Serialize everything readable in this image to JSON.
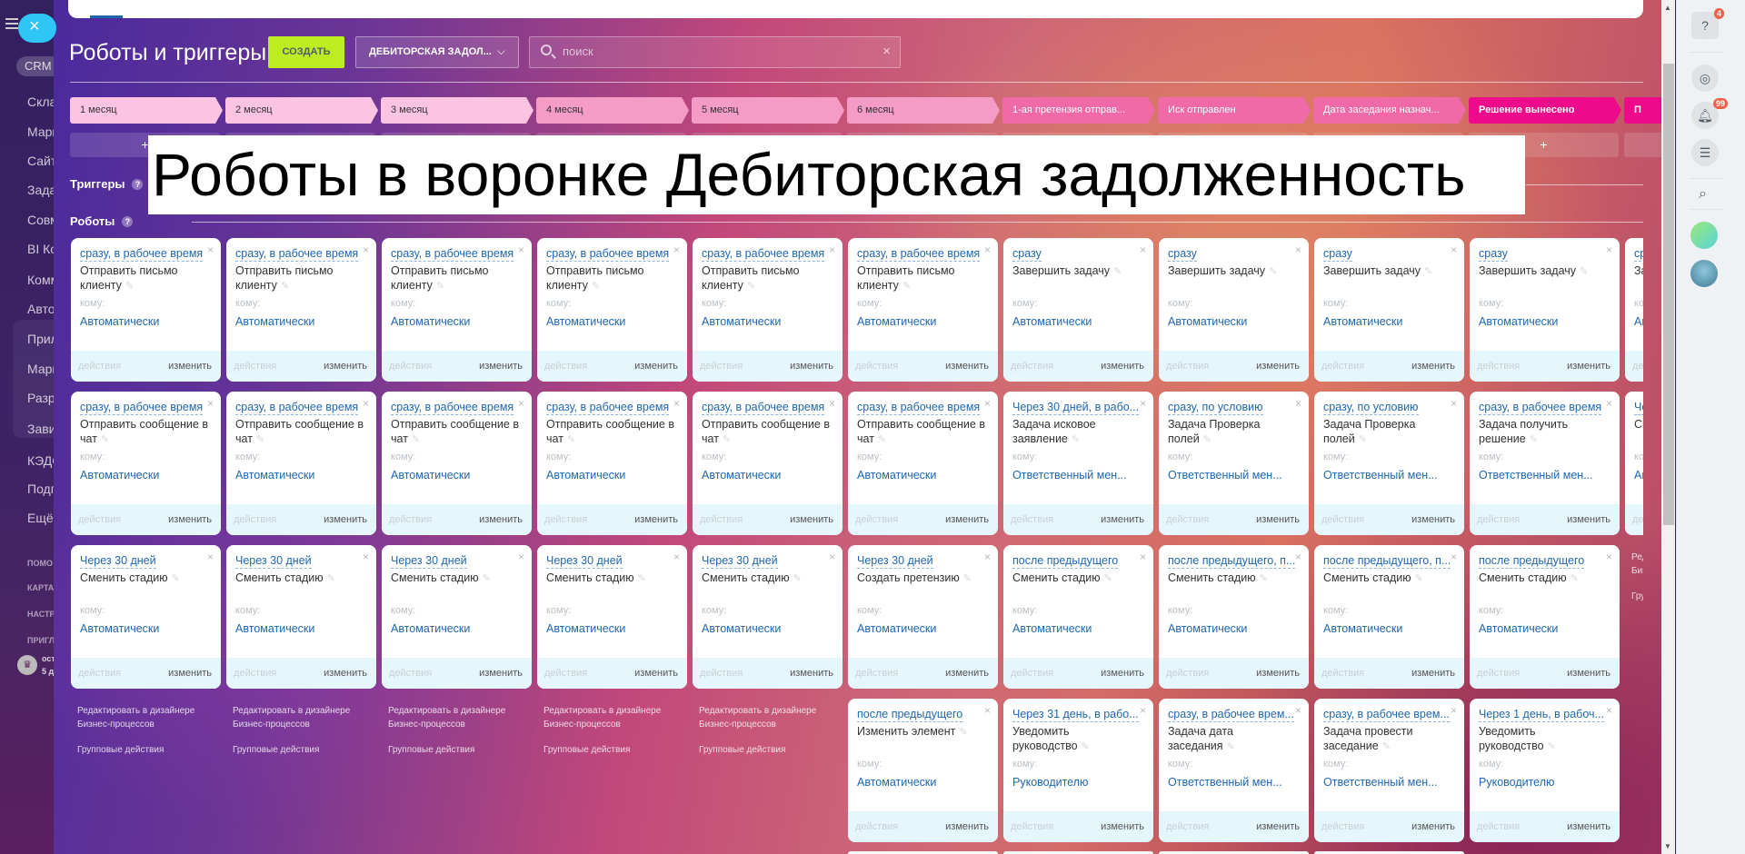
{
  "left_nav": {
    "crm": "CRM",
    "items": [
      "Скла",
      "Марк",
      "Сайт",
      "Зада",
      "Совм",
      "BI Ко",
      "Комм",
      "Авто",
      "Прил",
      "Марк",
      "Разр",
      "Зави",
      "КЭДО",
      "Подп",
      "Ещё"
    ],
    "small_items": [
      "ПОМО",
      "КАРТА",
      "НАСТР",
      "ПРИГЛ"
    ],
    "plan_line1": "ост",
    "plan_line2": "5 д"
  },
  "header": {
    "title": "Роботы и триггеры",
    "create_label": "СОЗДАТЬ",
    "funnel_selected": "ДЕБИТОРСКАЯ ЗАДОЛ...",
    "search_placeholder": "поиск"
  },
  "stages": [
    {
      "label": "1 месяц",
      "color": "#fdc3e3",
      "text": "#333"
    },
    {
      "label": "2 месяц",
      "color": "#fdc3e3",
      "text": "#333"
    },
    {
      "label": "3 месяц",
      "color": "#fdc3e3",
      "text": "#333"
    },
    {
      "label": "4 месяц",
      "color": "#f49bc6",
      "text": "#333"
    },
    {
      "label": "5 месяц",
      "color": "#f49bc6",
      "text": "#333"
    },
    {
      "label": "6 месяц",
      "color": "#f49bc6",
      "text": "#333"
    },
    {
      "label": "1-ая претензия отправ...",
      "color": "#f06aa8",
      "text": "#fff"
    },
    {
      "label": "Иск отправлен",
      "color": "#f06aa8",
      "text": "#fff"
    },
    {
      "label": "Дата заседания назнач...",
      "color": "#f06aa8",
      "text": "#fff"
    },
    {
      "label": "Решение вынесено",
      "color": "#ee0a8a",
      "text": "#fff"
    },
    {
      "label": "П",
      "color": "#ee0a8a",
      "text": "#fff"
    }
  ],
  "add_label": "+",
  "overlay_caption": "Роботы в воронке Дебиторская задолженность",
  "sections": {
    "triggers": "Триггеры",
    "robots": "Роботы",
    "help": "?"
  },
  "card_labels": {
    "to": "кому:",
    "actions": "действия",
    "edit": "изменить",
    "close": "×"
  },
  "columns": [
    {
      "cards": [
        {
          "cond": "сразу, в рабочее время",
          "title": "Отправить письмо клиенту",
          "resp": "Автоматически"
        },
        {
          "cond": "сразу, в рабочее время",
          "title": "Отправить сообщение в чат",
          "resp": "Автоматически"
        },
        {
          "cond": "Через 30 дней",
          "title": "Сменить стадию",
          "resp": "Автоматически"
        }
      ]
    },
    {
      "cards": [
        {
          "cond": "сразу, в рабочее время",
          "title": "Отправить письмо клиенту",
          "resp": "Автоматически"
        },
        {
          "cond": "сразу, в рабочее время",
          "title": "Отправить сообщение в чат",
          "resp": "Автоматически"
        },
        {
          "cond": "Через 30 дней",
          "title": "Сменить стадию",
          "resp": "Автоматически"
        }
      ]
    },
    {
      "cards": [
        {
          "cond": "сразу, в рабочее время",
          "title": "Отправить письмо клиенту",
          "resp": "Автоматически"
        },
        {
          "cond": "сразу, в рабочее время",
          "title": "Отправить сообщение в чат",
          "resp": "Автоматически"
        },
        {
          "cond": "Через 30 дней",
          "title": "Сменить стадию",
          "resp": "Автоматически"
        }
      ]
    },
    {
      "cards": [
        {
          "cond": "сразу, в рабочее время",
          "title": "Отправить письмо клиенту",
          "resp": "Автоматически"
        },
        {
          "cond": "сразу, в рабочее время",
          "title": "Отправить сообщение в чат",
          "resp": "Автоматически"
        },
        {
          "cond": "Через 30 дней",
          "title": "Сменить стадию",
          "resp": "Автоматически"
        }
      ]
    },
    {
      "cards": [
        {
          "cond": "сразу, в рабочее время",
          "title": "Отправить письмо клиенту",
          "resp": "Автоматически"
        },
        {
          "cond": "сразу, в рабочее время",
          "title": "Отправить сообщение в чат",
          "resp": "Автоматически"
        },
        {
          "cond": "Через 30 дней",
          "title": "Сменить стадию",
          "resp": "Автоматически"
        }
      ]
    },
    {
      "cards": [
        {
          "cond": "сразу, в рабочее время",
          "title": "Отправить письмо клиенту",
          "resp": "Автоматически"
        },
        {
          "cond": "сразу, в рабочее время",
          "title": "Отправить сообщение в чат",
          "resp": "Автоматически"
        },
        {
          "cond": "Через 30 дней",
          "title": "Создать претензию",
          "resp": "Автоматически"
        },
        {
          "cond": "после предыдущего",
          "title": "Изменить элемент",
          "resp": "Автоматически"
        },
        {
          "cond": "",
          "title": "",
          "resp": ""
        }
      ]
    },
    {
      "cards": [
        {
          "cond": "сразу",
          "title": "Завершить задачу",
          "resp": "Автоматически"
        },
        {
          "cond": "Через 30 дней, в рабо...",
          "title": "Задача исковое заявление",
          "resp": "Ответственный мен..."
        },
        {
          "cond": "после предыдущего",
          "title": "Сменить стадию",
          "resp": "Автоматически"
        },
        {
          "cond": "Через 31 день, в рабо...",
          "title": "Уведомить руководство",
          "resp": "Руководителю"
        },
        {
          "cond": "",
          "title": "",
          "resp": ""
        }
      ]
    },
    {
      "cards": [
        {
          "cond": "сразу",
          "title": "Завершить задачу",
          "resp": "Автоматически"
        },
        {
          "cond": "сразу, по условию",
          "title": "Задача Проверка полей",
          "resp": "Ответственный мен..."
        },
        {
          "cond": "после предыдущего, п...",
          "title": "Сменить стадию",
          "resp": "Автоматически"
        },
        {
          "cond": "сразу, в рабочее врем...",
          "title": "Задача дата заседания",
          "resp": "Ответственный мен..."
        },
        {
          "cond": "",
          "title": "",
          "resp": ""
        }
      ]
    },
    {
      "cards": [
        {
          "cond": "сразу",
          "title": "Завершить задачу",
          "resp": "Автоматически"
        },
        {
          "cond": "сразу, по условию",
          "title": "Задача Проверка полей",
          "resp": "Ответственный мен..."
        },
        {
          "cond": "после предыдущего, п...",
          "title": "Сменить стадию",
          "resp": "Автоматически"
        },
        {
          "cond": "сразу, в рабочее врем...",
          "title": "Задача провести заседание",
          "resp": "Ответственный мен..."
        },
        {
          "cond": "",
          "title": "",
          "resp": ""
        }
      ]
    },
    {
      "cards": [
        {
          "cond": "сразу",
          "title": "Завершить задачу",
          "resp": "Автоматически"
        },
        {
          "cond": "сразу, в рабочее время",
          "title": "Задача получить решение",
          "resp": "Ответственный мен..."
        },
        {
          "cond": "после предыдущего",
          "title": "Сменить стадию",
          "resp": "Автоматически"
        },
        {
          "cond": "Через 1 день, в рабоч...",
          "title": "Уведомить руководство",
          "resp": "Руководителю"
        }
      ]
    },
    {
      "cards": [
        {
          "cond": "ср",
          "title": "За",
          "resp": "Ав"
        },
        {
          "cond": "Че",
          "title": "См",
          "resp": "Ав"
        }
      ]
    }
  ],
  "column_links": {
    "designer_line1": "Редактировать в дизайнере",
    "designer_line2": "Бизнес-процессов",
    "group": "Групповые действия"
  },
  "right_bar": {
    "help_badge": "4",
    "notifications_badge": "99"
  },
  "colors": {
    "accent_create": "#bbed21",
    "link_blue": "#2067b0",
    "card_footer": "#e5f6fd"
  }
}
